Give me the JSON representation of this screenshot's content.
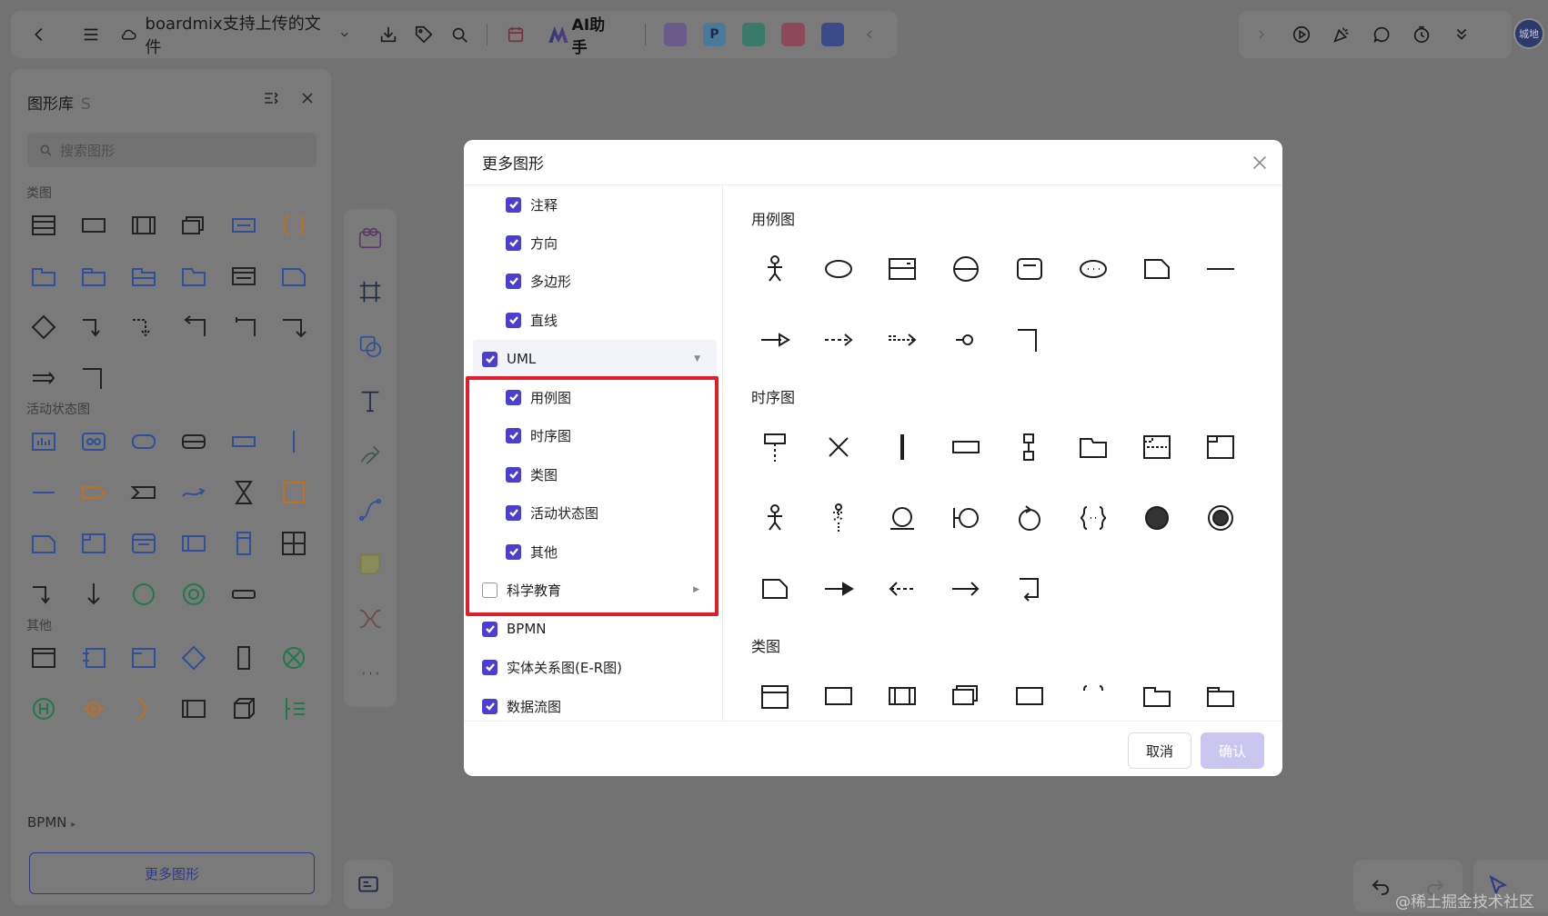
{
  "topbar": {
    "doc_title": "boardmix支持上传的文件",
    "ai_label": "AI助手"
  },
  "avatar_text": "城地",
  "left_panel": {
    "title": "图形库",
    "shortcut": "S",
    "search_placeholder": "搜索图形",
    "sections": [
      "类图",
      "活动状态图",
      "其他"
    ],
    "bpmn_label": "BPMN",
    "more_button": "更多图形"
  },
  "modal": {
    "title": "更多图形",
    "categories": [
      {
        "label": "注释",
        "checked": true,
        "level": 2
      },
      {
        "label": "方向",
        "checked": true,
        "level": 2
      },
      {
        "label": "多边形",
        "checked": true,
        "level": 2
      },
      {
        "label": "直线",
        "checked": true,
        "level": 2
      },
      {
        "label": "UML",
        "checked": true,
        "level": 1,
        "expanded": true
      },
      {
        "label": "用例图",
        "checked": true,
        "level": 2
      },
      {
        "label": "时序图",
        "checked": true,
        "level": 2
      },
      {
        "label": "类图",
        "checked": true,
        "level": 2
      },
      {
        "label": "活动状态图",
        "checked": true,
        "level": 2
      },
      {
        "label": "其他",
        "checked": true,
        "level": 2
      },
      {
        "label": "科学教育",
        "checked": false,
        "level": 1,
        "expanded": false
      },
      {
        "label": "BPMN",
        "checked": true,
        "level": 1
      },
      {
        "label": "实体关系图(E-R图)",
        "checked": true,
        "level": 1
      },
      {
        "label": "数据流图",
        "checked": true,
        "level": 1
      }
    ],
    "shape_sections": [
      "用例图",
      "时序图",
      "类图"
    ],
    "cancel_label": "取消",
    "confirm_label": "确认"
  },
  "watermark": "@稀土掘金技术社区",
  "colors": {
    "accent": "#4a3fd0",
    "highlight_border": "#e01e2b",
    "confirm_disabled": "#cac6ef",
    "overlay": "#727272"
  }
}
